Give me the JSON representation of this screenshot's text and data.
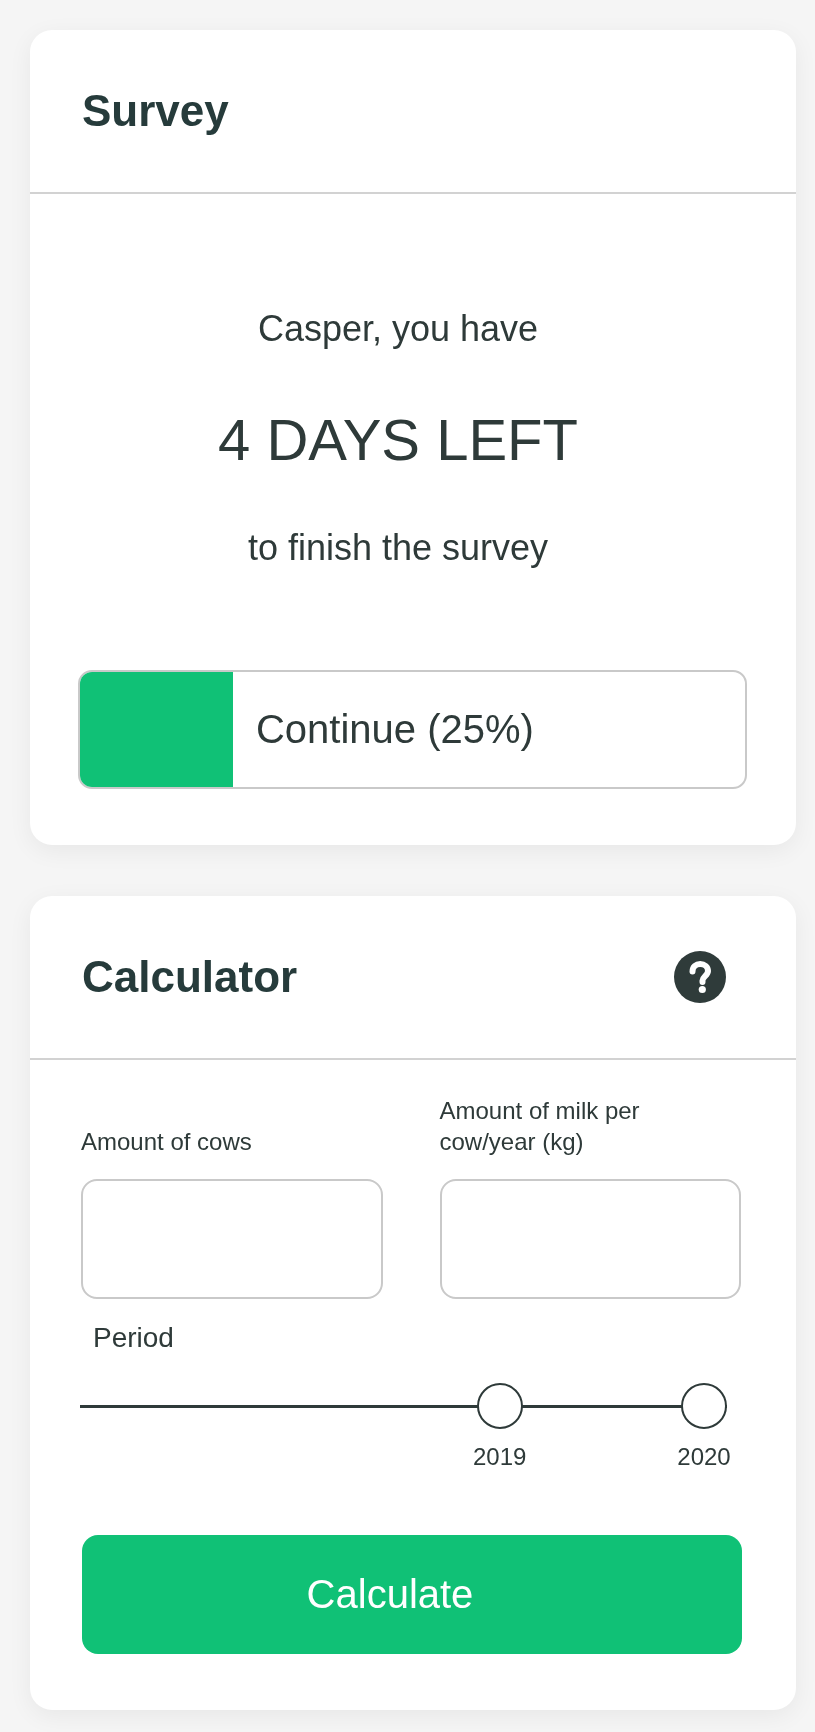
{
  "survey": {
    "title": "Survey",
    "greeting": "Casper, you have",
    "countdown": "4 DAYS LEFT",
    "subtitle": "to finish the survey",
    "progress": {
      "label": "Continue (25%)",
      "level": 0.23
    }
  },
  "calculator": {
    "title": "Calculator",
    "fields": [
      {
        "label": "Amount of cows"
      },
      {
        "label": "Amount of milk per cow/year (kg)"
      }
    ],
    "period": {
      "label": "Period",
      "thumbs": [
        {
          "label": "2019",
          "level": 0.66
        },
        {
          "label": "2020",
          "level": 1
        }
      ]
    },
    "button": "Calculate"
  }
}
